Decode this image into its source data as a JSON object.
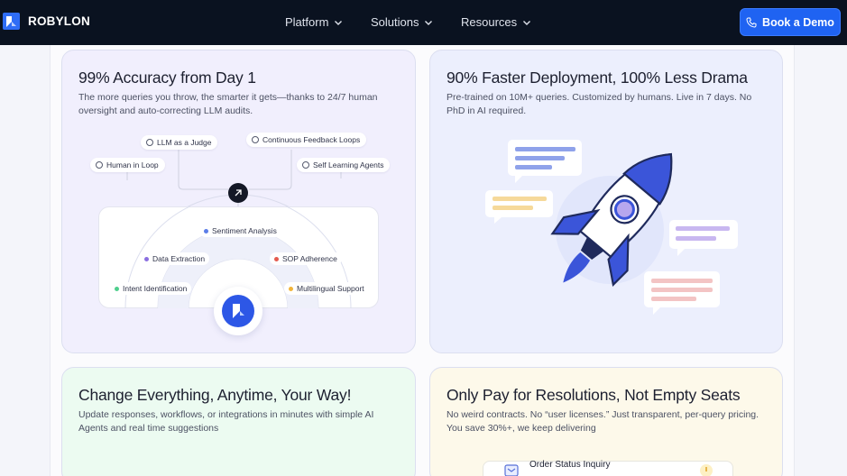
{
  "brand": {
    "name": "ROBYLON"
  },
  "nav": {
    "items": [
      {
        "label": "Platform"
      },
      {
        "label": "Solutions"
      },
      {
        "label": "Resources"
      }
    ],
    "cta_label": "Book a Demo"
  },
  "cards": [
    {
      "title": "99% Accuracy from Day 1",
      "description": "The more queries you throw, the smarter it gets—thanks to 24/7 human oversight and auto-correcting LLM audits.",
      "feedback_nodes": [
        {
          "label": "LLM as a Judge"
        },
        {
          "label": "Continuous Feedback Loops"
        },
        {
          "label": "Human in Loop"
        },
        {
          "label": "Self Learning Agents"
        }
      ],
      "capabilities": [
        {
          "label": "Sentiment Analysis",
          "color": "#5b7de8"
        },
        {
          "label": "Data Extraction",
          "color": "#8b6fe0"
        },
        {
          "label": "SOP Adherence",
          "color": "#e45b4f"
        },
        {
          "label": "Intent Identification",
          "color": "#4fcf8d"
        },
        {
          "label": "Multilingual Support",
          "color": "#f2b43a"
        }
      ]
    },
    {
      "title": "90% Faster Deployment, 100% Less Drama",
      "description": "Pre-trained on 10M+ queries. Customized by humans. Live in 7 days. No PhD in AI required."
    },
    {
      "title": "Change Everything, Anytime, Your Way!",
      "description": "Update responses, workflows, or integrations in minutes with simple AI Agents and real time suggestions"
    },
    {
      "title": "Only Pay for Resolutions, Not Empty Seats",
      "description": "No weird contracts. No “user licenses.” Just transparent, per-query pricing. You save 30%+, we keep delivering",
      "preview_item": "Order Status Inquiry"
    }
  ],
  "colors": {
    "nav_bg": "#0a1220",
    "accent": "#1f63f2",
    "rocket": "#3b55d9"
  },
  "icons": {
    "brand": "robylon-logo-icon",
    "chevron": "chevron-down-icon",
    "phone": "phone-icon",
    "hub": "sparkle-icon",
    "rocket": "rocket-icon"
  }
}
